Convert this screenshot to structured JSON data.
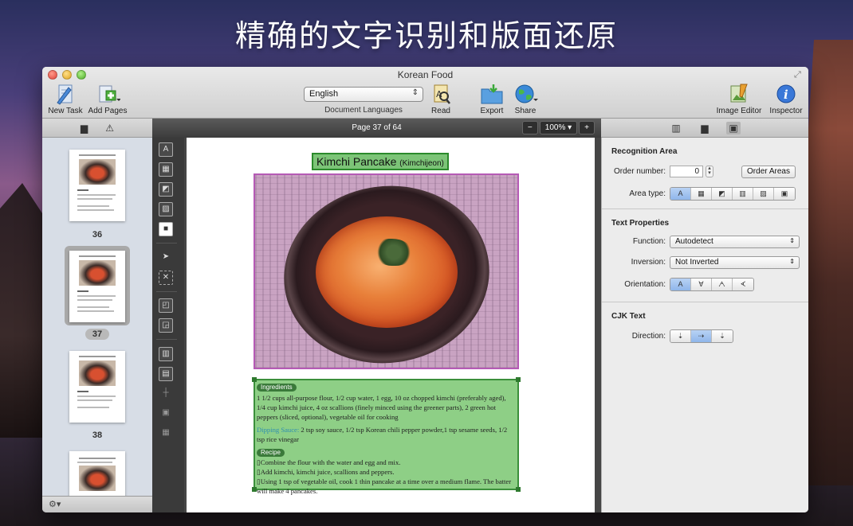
{
  "headline": "精确的文字识别和版面还原",
  "window": {
    "title": "Korean Food"
  },
  "toolbar": {
    "new_task": "New Task",
    "add_pages": "Add Pages",
    "language_value": "English",
    "language_caption": "Document Languages",
    "read": "Read",
    "export": "Export",
    "share": "Share",
    "image_editor": "Image Editor",
    "inspector": "Inspector"
  },
  "pagebar": {
    "page_label": "Page 37 of 64",
    "zoom_out": "−",
    "zoom_value": "100%",
    "zoom_in": "+"
  },
  "sidebar": {
    "pages": [
      {
        "number": "36"
      },
      {
        "number": "37",
        "selected": true
      },
      {
        "number": "38"
      }
    ],
    "gear_label": "⚙▾"
  },
  "document": {
    "title": "Kimchi Pancake",
    "title_sub": "(Kimchijeon)",
    "ingredients_label": "Ingredients",
    "ingredients_text": "1 1/2 cups all-purpose flour, 1/2 cup water, 1 egg, 10 oz chopped kimchi (preferably aged), 1/4 cup kimchi juice, 4 oz scallions (finely minced using the greener parts), 2 green hot peppers (sliced, optional), vegetable oil for cooking",
    "dipping_label": "Dipping Sauce:",
    "dipping_text": " 2 tsp soy sauce, 1/2 tsp Korean chili pepper powder,1 tsp sesame seeds, 1/2 tsp rice vinegar",
    "recipe_label": "Recipe",
    "steps": [
      "Combine the flour with the water and egg and mix.",
      "Add kimchi, kimchi juice, scallions and peppers.",
      "Using 1 tsp of vegetable oil, cook 1 thin pancake at a time over a medium flame. The batter will make 4 pancakes."
    ]
  },
  "inspector": {
    "recognition_area": {
      "title": "Recognition Area",
      "order_label": "Order number:",
      "order_value": "0",
      "order_button": "Order Areas",
      "area_type_label": "Area type:",
      "area_types": [
        "text-area-icon",
        "table-area-icon",
        "picture-area-icon",
        "barcode-area-icon",
        "background-picture-icon",
        "recognition-area-icon"
      ]
    },
    "text_properties": {
      "title": "Text Properties",
      "function_label": "Function:",
      "function_value": "Autodetect",
      "inversion_label": "Inversion:",
      "inversion_value": "Not Inverted",
      "orientation_label": "Orientation:"
    },
    "cjk": {
      "title": "CJK Text",
      "direction_label": "Direction:"
    }
  },
  "colors": {
    "text_area_fill": "#8ecf86",
    "text_area_border": "#3b8f3b",
    "picture_area_border": "#b55ab5",
    "accent_blue": "#8fb6ea"
  }
}
